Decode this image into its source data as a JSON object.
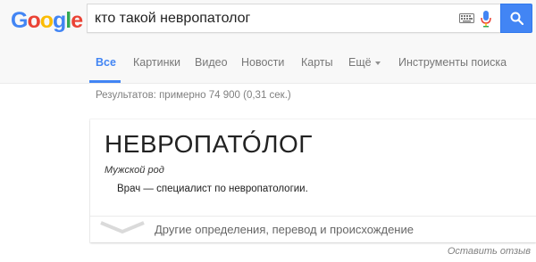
{
  "logo": {
    "letters": [
      "G",
      "o",
      "o",
      "g",
      "l",
      "e"
    ],
    "colors": [
      "#4285f4",
      "#ea4335",
      "#fbbc05",
      "#4285f4",
      "#34a853",
      "#ea4335"
    ]
  },
  "search": {
    "query": "кто такой невропатолог",
    "keyboard_icon": "keyboard-icon",
    "mic_icon": "microphone-icon",
    "button_icon": "magnifier-icon",
    "accent": "#4285f4"
  },
  "tabs": [
    {
      "label": "Все",
      "active": true
    },
    {
      "label": "Картинки",
      "active": false
    },
    {
      "label": "Видео",
      "active": false
    },
    {
      "label": "Новости",
      "active": false
    },
    {
      "label": "Карты",
      "active": false
    },
    {
      "label": "Ещё",
      "active": false
    },
    {
      "label": "Инструменты поиска",
      "active": false
    }
  ],
  "results_stats": "Результатов: примерно 74 900 (0,31 сек.)",
  "dictionary": {
    "word": "НЕВРОПАТО́ЛОГ",
    "gender": "Мужской род",
    "definition": "Врач — специалист по невропатологии.",
    "expand_label": "Другие определения, перевод и происхождение"
  },
  "feedback": "Оставить отзыв"
}
